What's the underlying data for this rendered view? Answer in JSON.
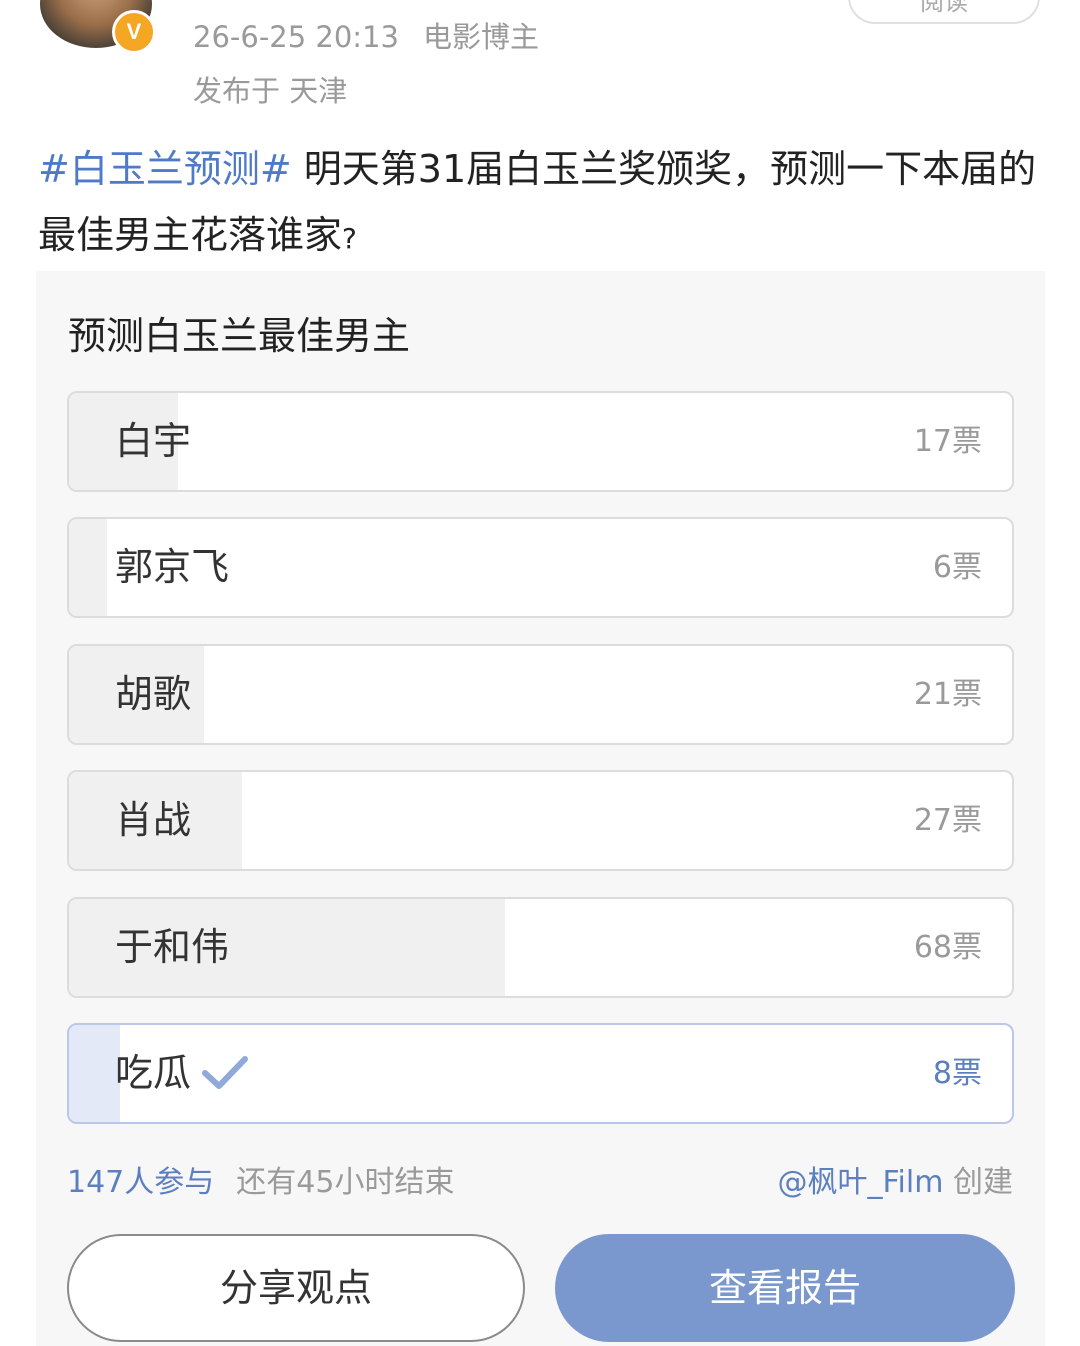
{
  "post": {
    "author": {
      "verified_icon": "v-badge-icon",
      "verified_label": "V"
    },
    "timestamp": "26-6-25 20:13",
    "author_tag": "电影博主",
    "location": "发布于 天津",
    "read_button": "阅读",
    "topic": "#白玉兰预测#",
    "text": " 明天第31届白玉兰奖颁奖，预测一下本届的最佳男主花落谁家",
    "question_mark": "?"
  },
  "poll": {
    "title": "预测白玉兰最佳男主",
    "total_votes": 147,
    "options": [
      {
        "label": "白宇",
        "votes_text": "17票",
        "votes": 17,
        "selected": false
      },
      {
        "label": "郭京飞",
        "votes_text": "6票",
        "votes": 6,
        "selected": false
      },
      {
        "label": "胡歌",
        "votes_text": "21票",
        "votes": 21,
        "selected": false
      },
      {
        "label": "肖战",
        "votes_text": "27票",
        "votes": 27,
        "selected": false
      },
      {
        "label": "于和伟",
        "votes_text": "68票",
        "votes": 68,
        "selected": false
      },
      {
        "label": "吃瓜",
        "votes_text": "8票",
        "votes": 8,
        "selected": true
      }
    ],
    "selected_icon": "check-icon",
    "participants": "147人参与",
    "remaining": "还有45小时结束",
    "creator": "@枫叶_Film",
    "creator_suffix": "创建",
    "share_button": "分享观点",
    "report_button": "查看报告"
  },
  "colors": {
    "link": "#4f7ac7",
    "primary_button": "#7a98cd",
    "verified": "#f5a623",
    "selected_fill": "#e3e9f6"
  }
}
